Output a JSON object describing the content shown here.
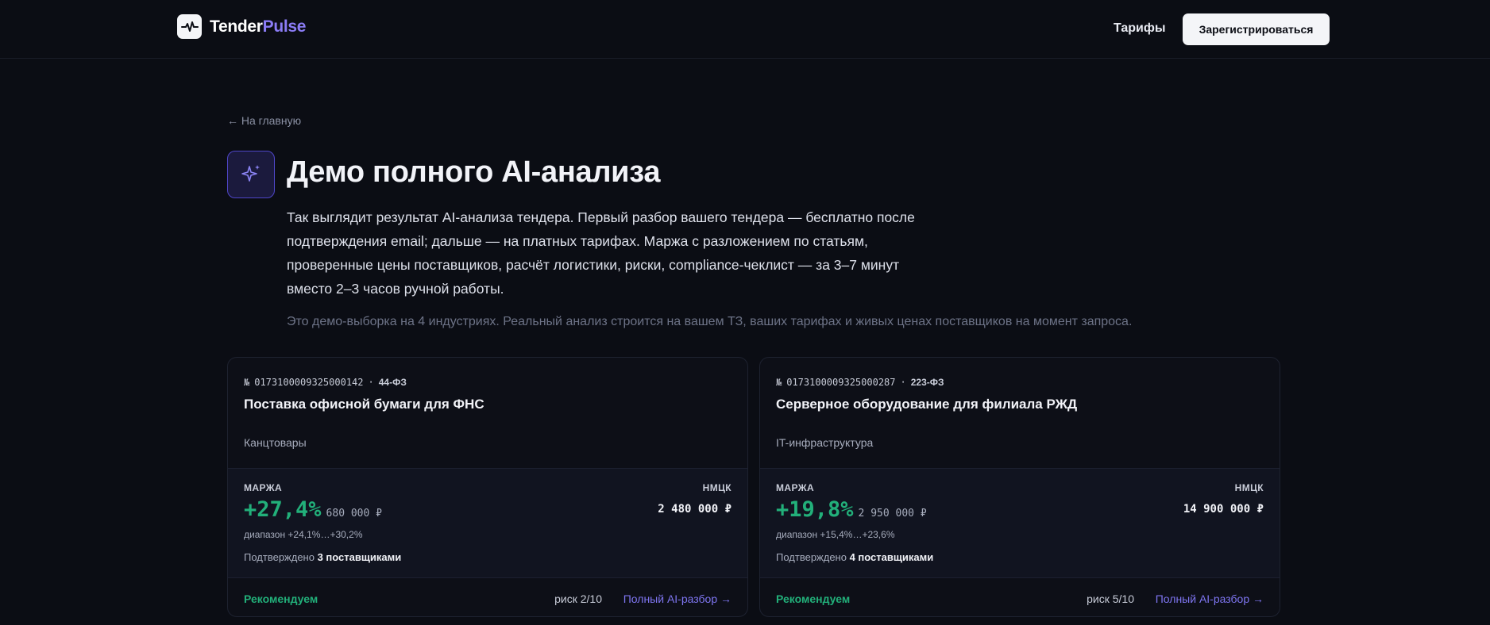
{
  "header": {
    "brand_part1": "Tender",
    "brand_part2": "Pulse",
    "nav_pricing": "Тарифы",
    "signup_label": "Зарегистрироваться"
  },
  "intro": {
    "back_link": "← На главную",
    "title": "Демо полного AI-анализа",
    "lead_lines": [
      "Так выглядит результат AI-анализа тендера. Первый разбор вашего тендера — бесплатно после",
      "подтверждения email; дальше — на платных тарифах. Маржа с разложением по статьям,",
      "проверенные цены поставщиков, расчёт логистики, риски, compliance-чеклист — за 3–7 минут",
      "вместо 2–3 часов ручной работы."
    ],
    "note": "Это демо-выборка на 4 индустриях. Реальный анализ строится на вашем ТЗ, ваших тарифах и живых ценах поставщиков на момент запроса."
  },
  "cards": [
    {
      "number_prefix": "№",
      "number": "0173100009325000142",
      "separator": "·",
      "law": "44-ФЗ",
      "title": "Поставка офисной бумаги для ФНС",
      "category": "Канцтовары",
      "margin_label": "МАРЖА",
      "margin_pct": "+27,4%",
      "margin_abs": "680 000 ₽",
      "nmck_label": "НМЦК",
      "nmck": "2 480 000 ₽",
      "range": "диапазон +24,1%…+30,2%",
      "confirmed_text": "Подтверждено",
      "confirmed_count": "3 поставщиками",
      "recommend": "Рекомендуем",
      "risk": "риск 2/10",
      "full_link": "Полный AI-разбор →"
    },
    {
      "number_prefix": "№",
      "number": "0173100009325000287",
      "separator": "·",
      "law": "223-ФЗ",
      "title": "Серверное оборудование для филиала РЖД",
      "category": "IT-инфраструктура",
      "margin_label": "МАРЖА",
      "margin_pct": "+19,8%",
      "margin_abs": "2 950 000 ₽",
      "nmck_label": "НМЦК",
      "nmck": "14 900 000 ₽",
      "range": "диапазон +15,4%…+23,6%",
      "confirmed_text": "Подтверждено",
      "confirmed_count": "4 поставщиками",
      "recommend": "Рекомендуем",
      "risk": "риск 5/10",
      "full_link": "Полный AI-разбор →"
    }
  ],
  "colors": {
    "background": "#0b0d14",
    "accent": "#8b7cf6",
    "positive": "#22b07a",
    "link": "#7f76f2"
  },
  "icons": {
    "logo": "pulse-icon",
    "title": "sparkles-icon"
  }
}
